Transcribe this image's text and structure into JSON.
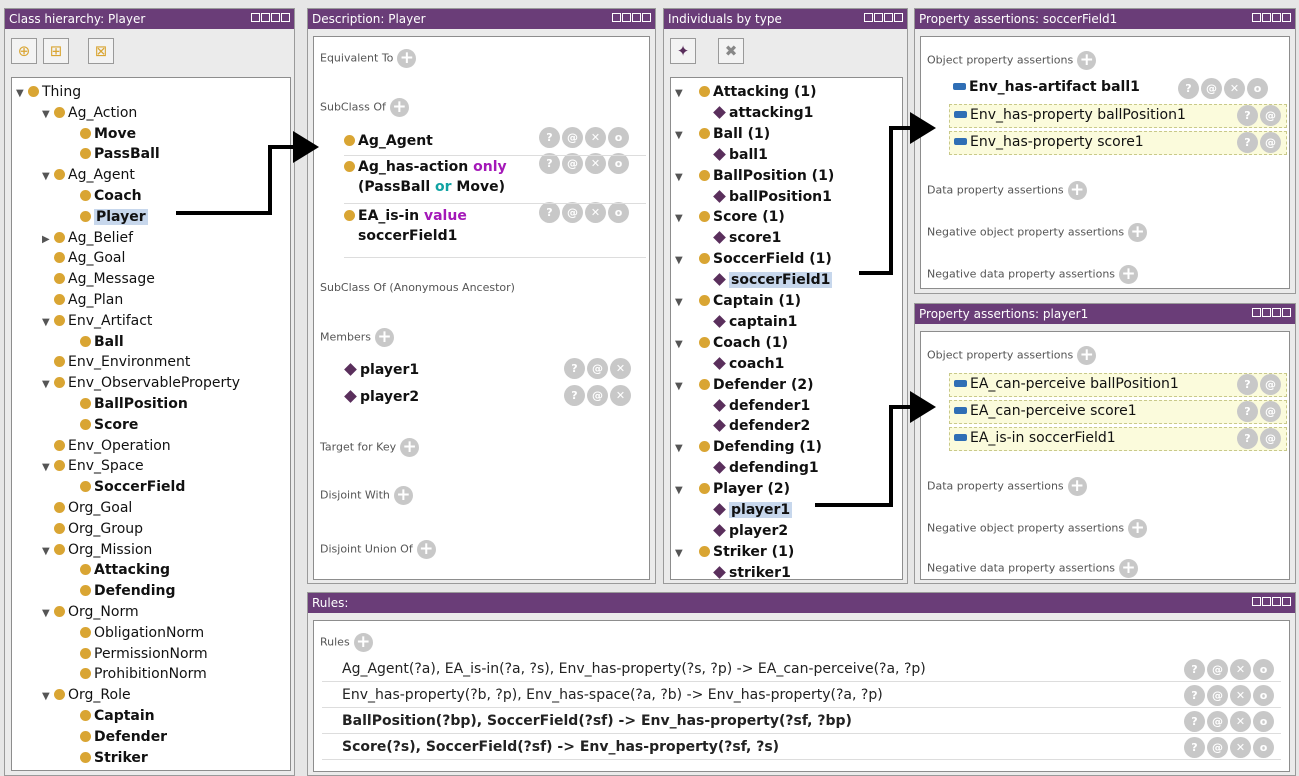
{
  "class_panel": {
    "title": "Class hierarchy: Player",
    "toolbar": [
      "add-subclass-icon",
      "add-sibling-icon",
      "delete-class-icon"
    ],
    "tree": [
      {
        "label": "Thing",
        "depth": 0,
        "toggle": "open",
        "bold": false,
        "selected": false
      },
      {
        "label": "Ag_Action",
        "depth": 1,
        "toggle": "open",
        "bold": false,
        "selected": false
      },
      {
        "label": "Move",
        "depth": 2,
        "toggle": "",
        "bold": true,
        "selected": false
      },
      {
        "label": "PassBall",
        "depth": 2,
        "toggle": "",
        "bold": true,
        "selected": false
      },
      {
        "label": "Ag_Agent",
        "depth": 1,
        "toggle": "open",
        "bold": false,
        "selected": false
      },
      {
        "label": "Coach",
        "depth": 2,
        "toggle": "",
        "bold": true,
        "selected": false
      },
      {
        "label": "Player",
        "depth": 2,
        "toggle": "",
        "bold": true,
        "selected": true
      },
      {
        "label": "Ag_Belief",
        "depth": 1,
        "toggle": "closed",
        "bold": false,
        "selected": false
      },
      {
        "label": "Ag_Goal",
        "depth": 1,
        "toggle": "",
        "bold": false,
        "selected": false
      },
      {
        "label": "Ag_Message",
        "depth": 1,
        "toggle": "",
        "bold": false,
        "selected": false
      },
      {
        "label": "Ag_Plan",
        "depth": 1,
        "toggle": "",
        "bold": false,
        "selected": false
      },
      {
        "label": "Env_Artifact",
        "depth": 1,
        "toggle": "open",
        "bold": false,
        "selected": false
      },
      {
        "label": "Ball",
        "depth": 2,
        "toggle": "",
        "bold": true,
        "selected": false
      },
      {
        "label": "Env_Environment",
        "depth": 1,
        "toggle": "",
        "bold": false,
        "selected": false
      },
      {
        "label": "Env_ObservableProperty",
        "depth": 1,
        "toggle": "open",
        "bold": false,
        "selected": false
      },
      {
        "label": "BallPosition",
        "depth": 2,
        "toggle": "",
        "bold": true,
        "selected": false
      },
      {
        "label": "Score",
        "depth": 2,
        "toggle": "",
        "bold": true,
        "selected": false
      },
      {
        "label": "Env_Operation",
        "depth": 1,
        "toggle": "",
        "bold": false,
        "selected": false
      },
      {
        "label": "Env_Space",
        "depth": 1,
        "toggle": "open",
        "bold": false,
        "selected": false
      },
      {
        "label": "SoccerField",
        "depth": 2,
        "toggle": "",
        "bold": true,
        "selected": false
      },
      {
        "label": "Org_Goal",
        "depth": 1,
        "toggle": "",
        "bold": false,
        "selected": false
      },
      {
        "label": "Org_Group",
        "depth": 1,
        "toggle": "",
        "bold": false,
        "selected": false
      },
      {
        "label": "Org_Mission",
        "depth": 1,
        "toggle": "open",
        "bold": false,
        "selected": false
      },
      {
        "label": "Attacking",
        "depth": 2,
        "toggle": "",
        "bold": true,
        "selected": false
      },
      {
        "label": "Defending",
        "depth": 2,
        "toggle": "",
        "bold": true,
        "selected": false
      },
      {
        "label": "Org_Norm",
        "depth": 1,
        "toggle": "open",
        "bold": false,
        "selected": false
      },
      {
        "label": "ObligationNorm",
        "depth": 2,
        "toggle": "",
        "bold": false,
        "selected": false
      },
      {
        "label": "PermissionNorm",
        "depth": 2,
        "toggle": "",
        "bold": false,
        "selected": false
      },
      {
        "label": "ProhibitionNorm",
        "depth": 2,
        "toggle": "",
        "bold": false,
        "selected": false
      },
      {
        "label": "Org_Role",
        "depth": 1,
        "toggle": "open",
        "bold": false,
        "selected": false
      },
      {
        "label": "Captain",
        "depth": 2,
        "toggle": "",
        "bold": true,
        "selected": false
      },
      {
        "label": "Defender",
        "depth": 2,
        "toggle": "",
        "bold": true,
        "selected": false
      },
      {
        "label": "Striker",
        "depth": 2,
        "toggle": "",
        "bold": true,
        "selected": false
      }
    ]
  },
  "description_panel": {
    "title": "Description: Player",
    "equivalent_to": "Equivalent To",
    "subclass_of": "SubClass Of",
    "subclass_items": [
      {
        "parts": [
          {
            "t": "Ag_Agent",
            "c": "b"
          }
        ]
      },
      {
        "parts": [
          {
            "t": "Ag_has-action ",
            "c": "b"
          },
          {
            "t": "only",
            "c": "only"
          },
          {
            "t": " (PassBall ",
            "c": "b"
          },
          {
            "t": "or",
            "c": "or"
          },
          {
            "t": " Move)",
            "c": "b"
          }
        ]
      },
      {
        "parts": [
          {
            "t": "EA_is-in ",
            "c": "b"
          },
          {
            "t": "value",
            "c": "only"
          },
          {
            "t": " soccerField1",
            "c": "b"
          }
        ]
      }
    ],
    "anonymous_ancestor": "SubClass Of (Anonymous Ancestor)",
    "members": "Members",
    "member_items": [
      "player1",
      "player2"
    ],
    "target_for_key": "Target for Key",
    "disjoint_with": "Disjoint With",
    "disjoint_union_of": "Disjoint Union Of"
  },
  "individuals_panel": {
    "title": "Individuals by type",
    "groups": [
      {
        "type": "Attacking (1)",
        "members": [
          "attacking1"
        ]
      },
      {
        "type": "Ball (1)",
        "members": [
          "ball1"
        ]
      },
      {
        "type": "BallPosition (1)",
        "members": [
          "ballPosition1"
        ]
      },
      {
        "type": "Score (1)",
        "members": [
          "score1"
        ]
      },
      {
        "type": "SoccerField (1)",
        "members": [
          "soccerField1"
        ]
      },
      {
        "type": "Captain (1)",
        "members": [
          "captain1"
        ]
      },
      {
        "type": "Coach (1)",
        "members": [
          "coach1"
        ]
      },
      {
        "type": "Defender (2)",
        "members": [
          "defender1",
          "defender2"
        ]
      },
      {
        "type": "Defending (1)",
        "members": [
          "defending1"
        ]
      },
      {
        "type": "Player (2)",
        "members": [
          "player1",
          "player2"
        ]
      },
      {
        "type": "Striker (1)",
        "members": [
          "striker1"
        ]
      }
    ],
    "selected": [
      "soccerField1",
      "player1"
    ]
  },
  "prop_panel_1": {
    "title": "Property assertions: soccerField1",
    "object_label": "Object property assertions",
    "object_items": [
      {
        "prop": "Env_has-artifact",
        "value": "ball1",
        "inferred": false
      },
      {
        "prop": "Env_has-property",
        "value": "ballPosition1",
        "inferred": true
      },
      {
        "prop": "Env_has-property",
        "value": "score1",
        "inferred": true
      }
    ],
    "data_label": "Data property assertions",
    "neg_object_label": "Negative object property assertions",
    "neg_data_label": "Negative data property assertions"
  },
  "prop_panel_2": {
    "title": "Property assertions: player1",
    "object_label": "Object property assertions",
    "object_items": [
      {
        "prop": "EA_can-perceive",
        "value": "ballPosition1",
        "inferred": true
      },
      {
        "prop": "EA_can-perceive",
        "value": "score1",
        "inferred": true
      },
      {
        "prop": "EA_is-in",
        "value": "soccerField1",
        "inferred": true
      }
    ],
    "data_label": "Data property assertions",
    "neg_object_label": "Negative object property assertions",
    "neg_data_label": "Negative data property assertions"
  },
  "rules_panel": {
    "title": "Rules:",
    "rules_label": "Rules",
    "rules": [
      {
        "text": "Ag_Agent(?a), EA_is-in(?a, ?s), Env_has-property(?s, ?p) -> EA_can-perceive(?a, ?p)",
        "bold": false
      },
      {
        "text": "Env_has-property(?b, ?p), Env_has-space(?a, ?b) -> Env_has-property(?a, ?p)",
        "bold": false
      },
      {
        "text": "BallPosition(?bp), SoccerField(?sf) -> Env_has-property(?sf, ?bp)",
        "bold": true
      },
      {
        "text": "Score(?s), SoccerField(?sf) -> Env_has-property(?sf, ?s)",
        "bold": true
      }
    ]
  },
  "buttons": {
    "help": "?",
    "annotate": "@",
    "delete": "✕",
    "edit": "o",
    "add": "+"
  },
  "colors": {
    "title_bar": "#6a3d78",
    "class_dot": "#d9a533",
    "individual": "#5a2f5c",
    "property_bar": "#2f6eb5",
    "only_keyword": "#a418b8",
    "or_keyword": "#11a3a3",
    "selection": "#c7d7ec",
    "inferred_bg": "#fbfbdc"
  }
}
